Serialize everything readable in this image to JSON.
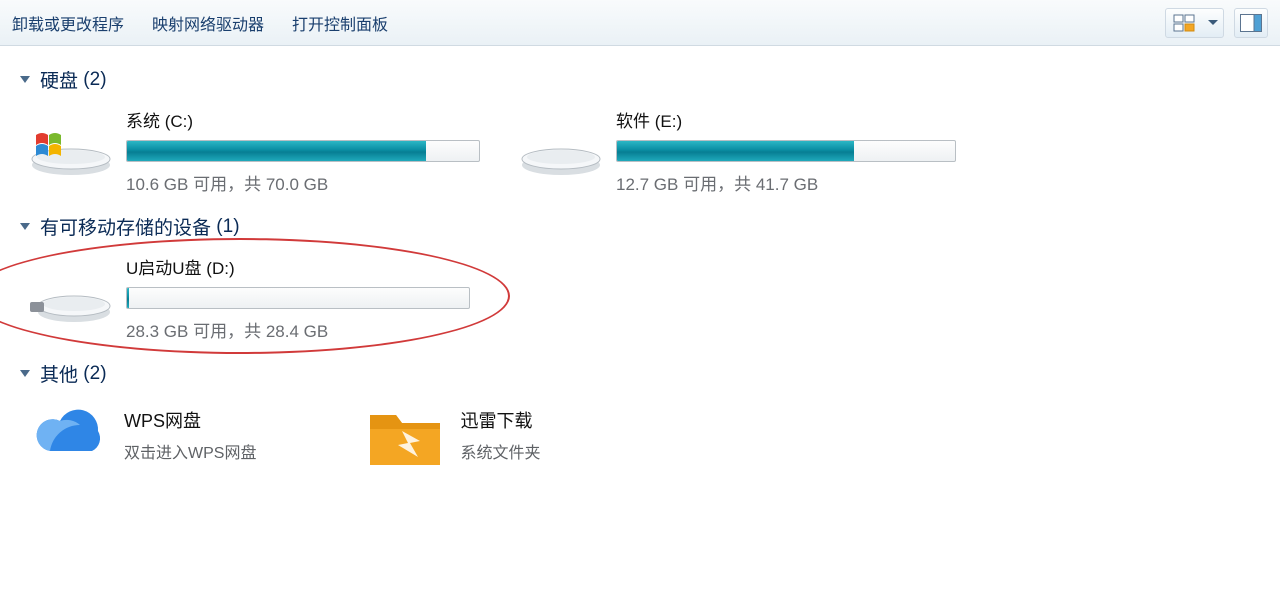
{
  "toolbar": {
    "uninstall": "卸载或更改程序",
    "map_drive": "映射网络驱动器",
    "control_panel": "打开控制面板"
  },
  "groups": {
    "hdd": {
      "label": "硬盘",
      "count": "(2)"
    },
    "removable": {
      "label": "有可移动存储的设备",
      "count": "(1)"
    },
    "other": {
      "label": "其他",
      "count": "(2)"
    }
  },
  "drives": {
    "c": {
      "title": "系统 (C:)",
      "size": "10.6 GB 可用，共 70.0 GB",
      "used_pct": 85
    },
    "e": {
      "title": "软件 (E:)",
      "size": "12.7 GB 可用，共 41.7 GB",
      "used_pct": 70
    },
    "d": {
      "title": "U启动U盘 (D:)",
      "size": "28.3 GB 可用，共 28.4 GB",
      "used_pct": 0.5
    }
  },
  "other_items": {
    "wps": {
      "title": "WPS网盘",
      "sub": "双击进入WPS网盘"
    },
    "xunlei": {
      "title": "迅雷下载",
      "sub": "系统文件夹"
    }
  }
}
